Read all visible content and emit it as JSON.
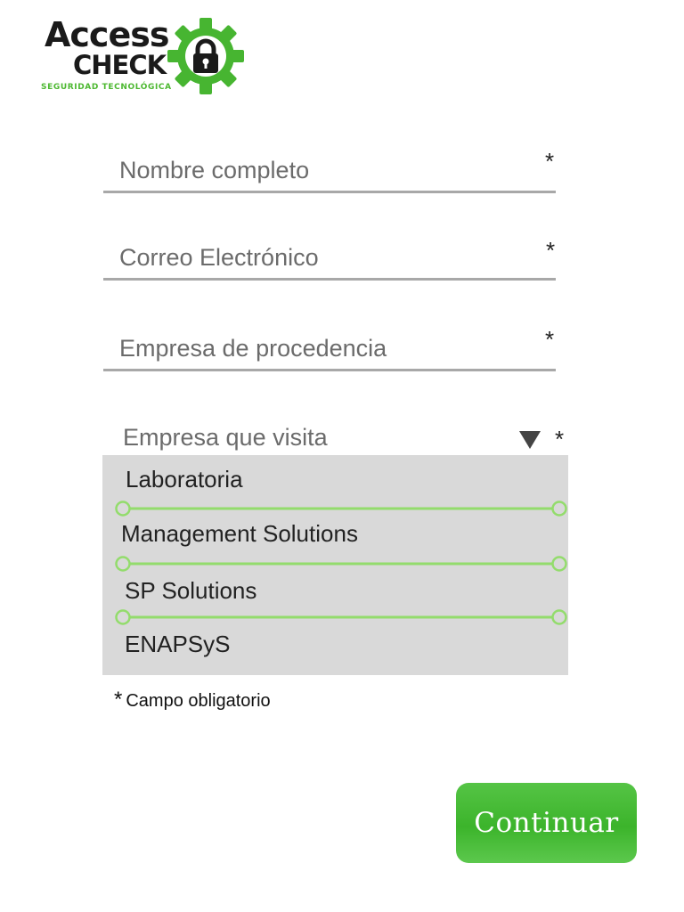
{
  "logo": {
    "line1": "Access",
    "line2": "CHECK",
    "tagline": "SEGURIDAD TECNOLÓGICA",
    "gear_color": "#47b531"
  },
  "form": {
    "fields": [
      {
        "placeholder": "Nombre completo",
        "value": "",
        "required_mark": "*"
      },
      {
        "placeholder": "Correo Electrónico",
        "value": "",
        "required_mark": "*"
      },
      {
        "placeholder": "Empresa de procedencia",
        "value": "",
        "required_mark": "*"
      }
    ],
    "company_select": {
      "placeholder": "Empresa que visita",
      "required_mark": "*",
      "options": [
        "Laboratoria",
        "Management Solutions",
        "SP Solutions",
        "ENAPSyS"
      ]
    },
    "note": {
      "star": "*",
      "text": "Campo obligatorio"
    }
  },
  "actions": {
    "continue_label": "Continuar"
  },
  "colors": {
    "accent_green": "#3cb42b",
    "separator_green": "#93dc6c",
    "dropdown_bg": "#d9d9d9",
    "underline": "#a8a8a8"
  }
}
